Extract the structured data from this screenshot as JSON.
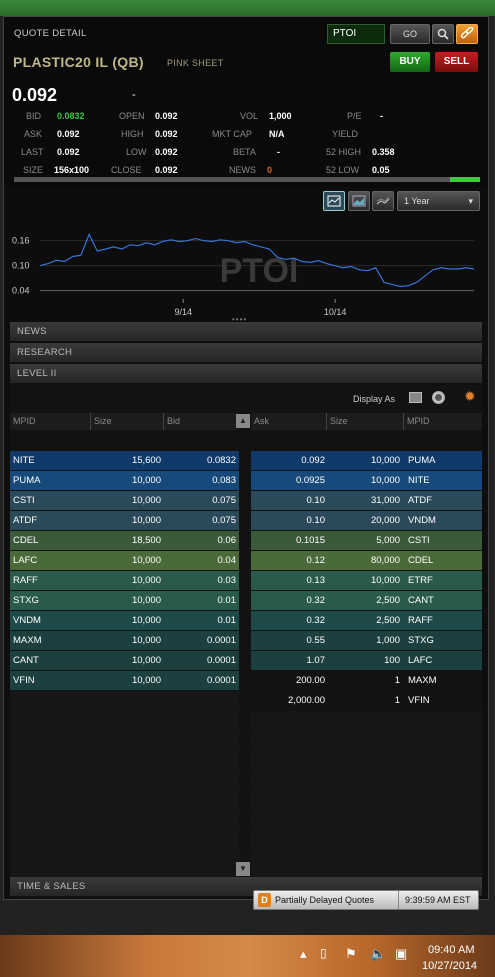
{
  "header": {
    "title": "QUOTE DETAIL",
    "symbol_input": "PTOI",
    "go_label": "GO",
    "buy_label": "BUY",
    "sell_label": "SELL",
    "security_name": "PLASTIC20 IL (QB)",
    "exchange": "PINK SHEET",
    "last_price": "0.092",
    "change": "-"
  },
  "quote": {
    "bid": {
      "label": "BID",
      "value": "0.0832"
    },
    "open": {
      "label": "OPEN",
      "value": "0.092"
    },
    "vol": {
      "label": "VOL",
      "value": "1,000"
    },
    "pe": {
      "label": "P/E",
      "value": "-"
    },
    "ask": {
      "label": "ASK",
      "value": "0.092"
    },
    "high": {
      "label": "HIGH",
      "value": "0.092"
    },
    "mktcap": {
      "label": "MKT CAP",
      "value": "N/A"
    },
    "yield": {
      "label": "YIELD",
      "value": ""
    },
    "lastp": {
      "label": "LAST",
      "value": "0.092"
    },
    "low": {
      "label": "LOW",
      "value": "0.092"
    },
    "beta": {
      "label": "BETA",
      "value": "-"
    },
    "high52": {
      "label": "52 HIGH",
      "value": "0.358"
    },
    "size": {
      "label": "SIZE",
      "value": "156x100"
    },
    "close": {
      "label": "CLOSE",
      "value": "0.092"
    },
    "news": {
      "label": "NEWS",
      "value": "0"
    },
    "low52": {
      "label": "52 LOW",
      "value": "0.05"
    }
  },
  "chart_controls": {
    "range": "1 Year"
  },
  "chart_data": {
    "type": "line",
    "watermark": "PTOI",
    "yticks": [
      "0.16",
      "0.10",
      "0.04"
    ],
    "xticks": [
      "9/14",
      "10/14"
    ],
    "ylim": [
      0.02,
      0.2
    ],
    "values": [
      0.1,
      0.105,
      0.113,
      0.11,
      0.122,
      0.125,
      0.175,
      0.135,
      0.14,
      0.145,
      0.14,
      0.15,
      0.148,
      0.155,
      0.15,
      0.158,
      0.162,
      0.158,
      0.16,
      0.165,
      0.16,
      0.158,
      0.162,
      0.16,
      0.155,
      0.158,
      0.15,
      0.145,
      0.14,
      0.12,
      0.115,
      0.118,
      0.11,
      0.108,
      0.112,
      0.105,
      0.1,
      0.095,
      0.098,
      0.09,
      0.088,
      0.095,
      0.06,
      0.055,
      0.05,
      0.052,
      0.06,
      0.075,
      0.09,
      0.095,
      0.092,
      0.092,
      0.095,
      0.092
    ]
  },
  "sections": {
    "news": "NEWS",
    "research": "RESEARCH",
    "level2": "LEVEL II",
    "time_sales": "TIME & SALES"
  },
  "level2": {
    "display_as": "Display As",
    "bid_headers": [
      "MPID",
      "Size",
      "Bid"
    ],
    "ask_headers": [
      "Ask",
      "Size",
      "MPID"
    ],
    "bids": [
      {
        "mpid": "NITE",
        "size": "15,600",
        "price": "0.0832"
      },
      {
        "mpid": "PUMA",
        "size": "10,000",
        "price": "0.083"
      },
      {
        "mpid": "CSTI",
        "size": "10,000",
        "price": "0.075"
      },
      {
        "mpid": "ATDF",
        "size": "10,000",
        "price": "0.075"
      },
      {
        "mpid": "CDEL",
        "size": "18,500",
        "price": "0.06"
      },
      {
        "mpid": "LAFC",
        "size": "10,000",
        "price": "0.04"
      },
      {
        "mpid": "RAFF",
        "size": "10,000",
        "price": "0.03"
      },
      {
        "mpid": "STXG",
        "size": "10,000",
        "price": "0.01"
      },
      {
        "mpid": "VNDM",
        "size": "10,000",
        "price": "0.01"
      },
      {
        "mpid": "MAXM",
        "size": "10,000",
        "price": "0.0001"
      },
      {
        "mpid": "CANT",
        "size": "10,000",
        "price": "0.0001"
      },
      {
        "mpid": "VFIN",
        "size": "10,000",
        "price": "0.0001"
      }
    ],
    "asks": [
      {
        "price": "0.092",
        "size": "10,000",
        "mpid": "PUMA"
      },
      {
        "price": "0.0925",
        "size": "10,000",
        "mpid": "NITE"
      },
      {
        "price": "0.10",
        "size": "31,000",
        "mpid": "ATDF"
      },
      {
        "price": "0.10",
        "size": "20,000",
        "mpid": "VNDM"
      },
      {
        "price": "0.1015",
        "size": "5,000",
        "mpid": "CSTI"
      },
      {
        "price": "0.12",
        "size": "80,000",
        "mpid": "CDEL"
      },
      {
        "price": "0.13",
        "size": "10,000",
        "mpid": "ETRF"
      },
      {
        "price": "0.32",
        "size": "2,500",
        "mpid": "CANT"
      },
      {
        "price": "0.32",
        "size": "2,500",
        "mpid": "RAFF"
      },
      {
        "price": "0.55",
        "size": "1,000",
        "mpid": "STXG"
      },
      {
        "price": "1.07",
        "size": "100",
        "mpid": "LAFC"
      },
      {
        "price": "200.00",
        "size": "1",
        "mpid": "MAXM"
      },
      {
        "price": "2,000.00",
        "size": "1",
        "mpid": "VFIN"
      }
    ],
    "bid_colors": [
      "#0f3a6a",
      "#174a7a",
      "#2a4a5a",
      "#2a4a5a",
      "#3a5a3a",
      "#4a6a3a",
      "#2a5a4a",
      "#2a5a4a",
      "#1f4a4a",
      "#1c3f3f",
      "#1c3f3f",
      "#1c3f3f"
    ],
    "ask_colors": [
      "#0f3a6a",
      "#174a7a",
      "#2a4a5a",
      "#2a4a5a",
      "#3a5a3a",
      "#4a6a3a",
      "#2a5a4a",
      "#2a5a4a",
      "#1f4a4a",
      "#1c3f3f",
      "#1c3f3f",
      "#121212",
      "#121212"
    ]
  },
  "status": {
    "badge": "D",
    "label": "Partially Delayed Quotes",
    "time": "9:39:59 AM EST"
  },
  "taskbar": {
    "time": "09:40 AM",
    "date": "10/27/2014"
  }
}
